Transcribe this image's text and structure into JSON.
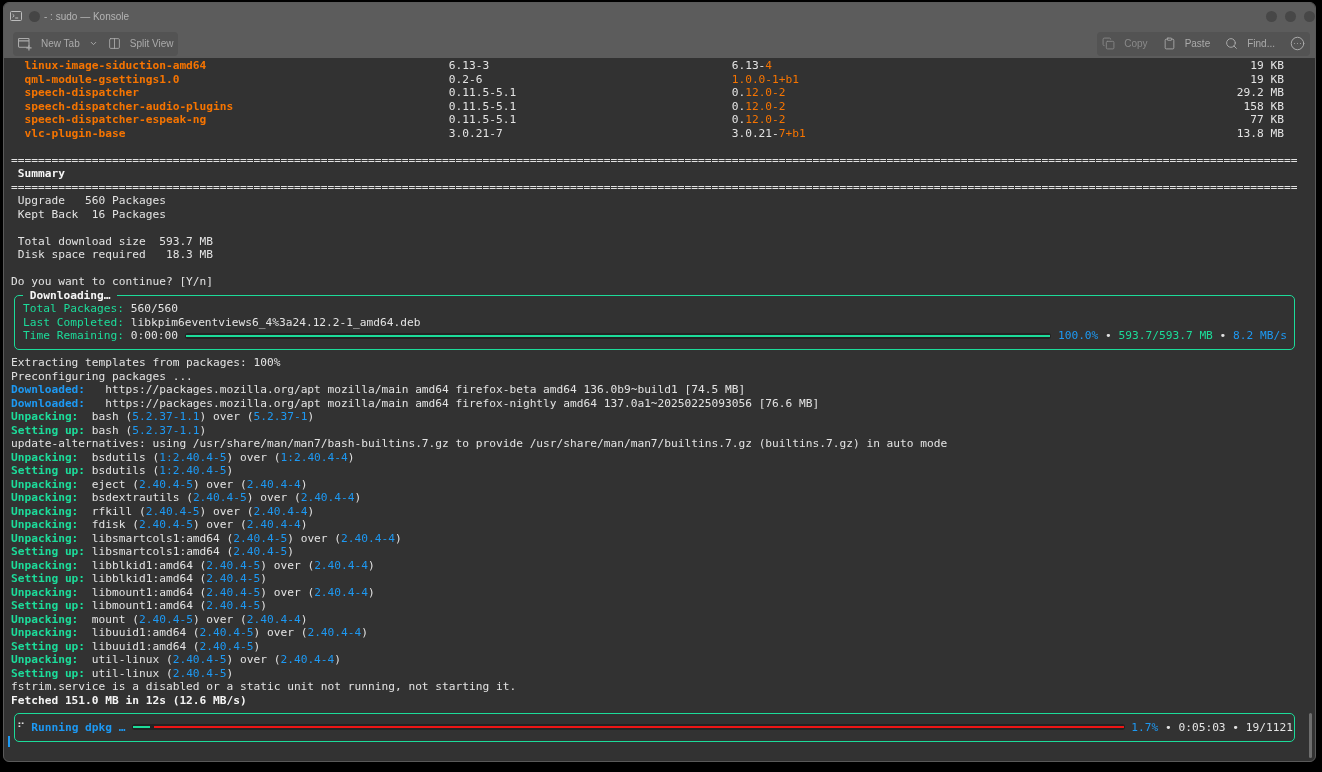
{
  "window": {
    "title": "- : sudo — Konsole"
  },
  "toolbar": {
    "left": [
      {
        "kind": "new_tab",
        "label": "New Tab"
      },
      {
        "kind": "split_view",
        "label": "Split View"
      }
    ],
    "right": [
      {
        "kind": "copy",
        "label": "Copy",
        "disabled": true
      },
      {
        "kind": "paste",
        "label": "Paste",
        "disabled": false
      },
      {
        "kind": "find",
        "label": "Find...",
        "disabled": false
      },
      {
        "kind": "menu",
        "disabled": false
      }
    ]
  },
  "packages": [
    {
      "name": "linux-image-siduction-amd64",
      "old_version": "6.13-3",
      "new_version": [
        {
          "text": "6.13-",
          "changed": false
        },
        {
          "text": "4",
          "changed": true
        }
      ],
      "size": "19 KB"
    },
    {
      "name": "qml-module-gsettings1.0",
      "old_version": "0.2-6",
      "new_version": [
        {
          "text": "1.0.0-1+b1",
          "changed": true
        }
      ],
      "size": "19 KB"
    },
    {
      "name": "speech-dispatcher",
      "old_version": "0.11.5-5.1",
      "new_version": [
        {
          "text": "0.",
          "changed": false
        },
        {
          "text": "12.0-2",
          "changed": true
        }
      ],
      "size": "29.2 MB"
    },
    {
      "name": "speech-dispatcher-audio-plugins",
      "old_version": "0.11.5-5.1",
      "new_version": [
        {
          "text": "0.",
          "changed": false
        },
        {
          "text": "12.0-2",
          "changed": true
        }
      ],
      "size": "158 KB"
    },
    {
      "name": "speech-dispatcher-espeak-ng",
      "old_version": "0.11.5-5.1",
      "new_version": [
        {
          "text": "0.",
          "changed": false
        },
        {
          "text": "12.0-2",
          "changed": true
        }
      ],
      "size": "77 KB"
    },
    {
      "name": "vlc-plugin-base",
      "old_version": "3.0.21-7",
      "new_version": [
        {
          "text": "3.0.21-",
          "changed": false
        },
        {
          "text": "7+b1",
          "changed": true
        }
      ],
      "size": "13.8 MB"
    }
  ],
  "summary": {
    "rule_top": "===============================================================================================================================================================================================",
    "title": "Summary",
    "rule_bottom": "===============================================================================================================================================================================================",
    "counts": [
      "Upgrade   560 Packages",
      "Kept Back  16 Packages"
    ],
    "sizes": [
      "Total download size  593.7 MB",
      "Disk space required   18.3 MB"
    ]
  },
  "prompt": "Do you want to continue? [Y/n]",
  "downloading": {
    "title": "Downloading…",
    "rows": [
      {
        "label": "Total Packages:",
        "value": "560/560"
      },
      {
        "label": "Last Completed:",
        "value": "libkpim6eventviews6_4%3a24.12.2-1_amd64.deb"
      },
      {
        "label": "Time Remaining:",
        "value": "0:00:00"
      }
    ],
    "progress": {
      "level": 1
    },
    "stats": [
      {
        "kind": "percent",
        "text": "100.0%"
      },
      {
        "kind": "plain",
        "text": " • "
      },
      {
        "kind": "size",
        "text": "593.7/593.7 MB"
      },
      {
        "kind": "plain",
        "text": " • "
      },
      {
        "kind": "speed",
        "text": "8.2 MB/s"
      }
    ]
  },
  "log": [
    {
      "segments": [
        {
          "kind": "plain",
          "text": "Extracting templates from packages: 100%"
        }
      ]
    },
    {
      "segments": [
        {
          "kind": "plain",
          "text": "Preconfiguring packages ..."
        }
      ]
    },
    {
      "segments": [
        {
          "kind": "download_label",
          "text": "Downloaded:"
        },
        {
          "kind": "plain",
          "text": "   https://packages.mozilla.org/apt mozilla/main amd64 firefox-beta amd64 136.0b9~build1 [74.5 MB]"
        }
      ]
    },
    {
      "segments": [
        {
          "kind": "download_label",
          "text": "Downloaded:"
        },
        {
          "kind": "plain",
          "text": "   https://packages.mozilla.org/apt mozilla/main amd64 firefox-nightly amd64 137.0a1~20250225093056 [76.6 MB]"
        }
      ]
    },
    {
      "segments": [
        {
          "kind": "step_label",
          "text": "Unpacking:"
        },
        {
          "kind": "plain",
          "text": "  bash ("
        },
        {
          "kind": "version",
          "text": "5.2.37-1.1"
        },
        {
          "kind": "plain",
          "text": ") over ("
        },
        {
          "kind": "version",
          "text": "5.2.37-1"
        },
        {
          "kind": "plain",
          "text": ")"
        }
      ]
    },
    {
      "segments": [
        {
          "kind": "step_label",
          "text": "Setting up:"
        },
        {
          "kind": "plain",
          "text": " bash ("
        },
        {
          "kind": "version",
          "text": "5.2.37-1.1"
        },
        {
          "kind": "plain",
          "text": ")"
        }
      ]
    },
    {
      "segments": [
        {
          "kind": "plain",
          "text": "update-alternatives: using /usr/share/man/man7/bash-builtins.7.gz to provide /usr/share/man/man7/builtins.7.gz (builtins.7.gz) in auto mode"
        }
      ]
    },
    {
      "segments": [
        {
          "kind": "step_label",
          "text": "Unpacking:"
        },
        {
          "kind": "plain",
          "text": "  bsdutils ("
        },
        {
          "kind": "version",
          "text": "1:2.40.4-5"
        },
        {
          "kind": "plain",
          "text": ") over ("
        },
        {
          "kind": "version",
          "text": "1:2.40.4-4"
        },
        {
          "kind": "plain",
          "text": ")"
        }
      ]
    },
    {
      "segments": [
        {
          "kind": "step_label",
          "text": "Setting up:"
        },
        {
          "kind": "plain",
          "text": " bsdutils ("
        },
        {
          "kind": "version",
          "text": "1:2.40.4-5"
        },
        {
          "kind": "plain",
          "text": ")"
        }
      ]
    },
    {
      "segments": [
        {
          "kind": "step_label",
          "text": "Unpacking:"
        },
        {
          "kind": "plain",
          "text": "  eject ("
        },
        {
          "kind": "version",
          "text": "2.40.4-5"
        },
        {
          "kind": "plain",
          "text": ") over ("
        },
        {
          "kind": "version",
          "text": "2.40.4-4"
        },
        {
          "kind": "plain",
          "text": ")"
        }
      ]
    },
    {
      "segments": [
        {
          "kind": "step_label",
          "text": "Unpacking:"
        },
        {
          "kind": "plain",
          "text": "  bsdextrautils ("
        },
        {
          "kind": "version",
          "text": "2.40.4-5"
        },
        {
          "kind": "plain",
          "text": ") over ("
        },
        {
          "kind": "version",
          "text": "2.40.4-4"
        },
        {
          "kind": "plain",
          "text": ")"
        }
      ]
    },
    {
      "segments": [
        {
          "kind": "step_label",
          "text": "Unpacking:"
        },
        {
          "kind": "plain",
          "text": "  rfkill ("
        },
        {
          "kind": "version",
          "text": "2.40.4-5"
        },
        {
          "kind": "plain",
          "text": ") over ("
        },
        {
          "kind": "version",
          "text": "2.40.4-4"
        },
        {
          "kind": "plain",
          "text": ")"
        }
      ]
    },
    {
      "segments": [
        {
          "kind": "step_label",
          "text": "Unpacking:"
        },
        {
          "kind": "plain",
          "text": "  fdisk ("
        },
        {
          "kind": "version",
          "text": "2.40.4-5"
        },
        {
          "kind": "plain",
          "text": ") over ("
        },
        {
          "kind": "version",
          "text": "2.40.4-4"
        },
        {
          "kind": "plain",
          "text": ")"
        }
      ]
    },
    {
      "segments": [
        {
          "kind": "step_label",
          "text": "Unpacking:"
        },
        {
          "kind": "plain",
          "text": "  libsmartcols1:amd64 ("
        },
        {
          "kind": "version",
          "text": "2.40.4-5"
        },
        {
          "kind": "plain",
          "text": ") over ("
        },
        {
          "kind": "version",
          "text": "2.40.4-4"
        },
        {
          "kind": "plain",
          "text": ")"
        }
      ]
    },
    {
      "segments": [
        {
          "kind": "step_label",
          "text": "Setting up:"
        },
        {
          "kind": "plain",
          "text": " libsmartcols1:amd64 ("
        },
        {
          "kind": "version",
          "text": "2.40.4-5"
        },
        {
          "kind": "plain",
          "text": ")"
        }
      ]
    },
    {
      "segments": [
        {
          "kind": "step_label",
          "text": "Unpacking:"
        },
        {
          "kind": "plain",
          "text": "  libblkid1:amd64 ("
        },
        {
          "kind": "version",
          "text": "2.40.4-5"
        },
        {
          "kind": "plain",
          "text": ") over ("
        },
        {
          "kind": "version",
          "text": "2.40.4-4"
        },
        {
          "kind": "plain",
          "text": ")"
        }
      ]
    },
    {
      "segments": [
        {
          "kind": "step_label",
          "text": "Setting up:"
        },
        {
          "kind": "plain",
          "text": " libblkid1:amd64 ("
        },
        {
          "kind": "version",
          "text": "2.40.4-5"
        },
        {
          "kind": "plain",
          "text": ")"
        }
      ]
    },
    {
      "segments": [
        {
          "kind": "step_label",
          "text": "Unpacking:"
        },
        {
          "kind": "plain",
          "text": "  libmount1:amd64 ("
        },
        {
          "kind": "version",
          "text": "2.40.4-5"
        },
        {
          "kind": "plain",
          "text": ") over ("
        },
        {
          "kind": "version",
          "text": "2.40.4-4"
        },
        {
          "kind": "plain",
          "text": ")"
        }
      ]
    },
    {
      "segments": [
        {
          "kind": "step_label",
          "text": "Setting up:"
        },
        {
          "kind": "plain",
          "text": " libmount1:amd64 ("
        },
        {
          "kind": "version",
          "text": "2.40.4-5"
        },
        {
          "kind": "plain",
          "text": ")"
        }
      ]
    },
    {
      "segments": [
        {
          "kind": "step_label",
          "text": "Unpacking:"
        },
        {
          "kind": "plain",
          "text": "  mount ("
        },
        {
          "kind": "version",
          "text": "2.40.4-5"
        },
        {
          "kind": "plain",
          "text": ") over ("
        },
        {
          "kind": "version",
          "text": "2.40.4-4"
        },
        {
          "kind": "plain",
          "text": ")"
        }
      ]
    },
    {
      "segments": [
        {
          "kind": "step_label",
          "text": "Unpacking:"
        },
        {
          "kind": "plain",
          "text": "  libuuid1:amd64 ("
        },
        {
          "kind": "version",
          "text": "2.40.4-5"
        },
        {
          "kind": "plain",
          "text": ") over ("
        },
        {
          "kind": "version",
          "text": "2.40.4-4"
        },
        {
          "kind": "plain",
          "text": ")"
        }
      ]
    },
    {
      "segments": [
        {
          "kind": "step_label",
          "text": "Setting up:"
        },
        {
          "kind": "plain",
          "text": " libuuid1:amd64 ("
        },
        {
          "kind": "version",
          "text": "2.40.4-5"
        },
        {
          "kind": "plain",
          "text": ")"
        }
      ]
    },
    {
      "segments": [
        {
          "kind": "step_label",
          "text": "Unpacking:"
        },
        {
          "kind": "plain",
          "text": "  util-linux ("
        },
        {
          "kind": "version",
          "text": "2.40.4-5"
        },
        {
          "kind": "plain",
          "text": ") over ("
        },
        {
          "kind": "version",
          "text": "2.40.4-4"
        },
        {
          "kind": "plain",
          "text": ")"
        }
      ]
    },
    {
      "segments": [
        {
          "kind": "step_label",
          "text": "Setting up:"
        },
        {
          "kind": "plain",
          "text": " util-linux ("
        },
        {
          "kind": "version",
          "text": "2.40.4-5"
        },
        {
          "kind": "plain",
          "text": ")"
        }
      ]
    },
    {
      "segments": [
        {
          "kind": "plain",
          "text": "fstrim.service is a disabled or a static unit not running, not starting it."
        }
      ]
    },
    {
      "segments": [
        {
          "kind": "bold",
          "text": "Fetched 151.0 MB in 12s (12.6 MB/s)"
        }
      ]
    }
  ],
  "running": {
    "spinner": "⠋",
    "label": "Running dpkg …",
    "progress": {
      "level": 0.017
    },
    "stats": [
      {
        "kind": "percent",
        "text": "1.7%"
      },
      {
        "kind": "plain",
        "text": " • 0:05:03 • 19/1121"
      }
    ]
  }
}
